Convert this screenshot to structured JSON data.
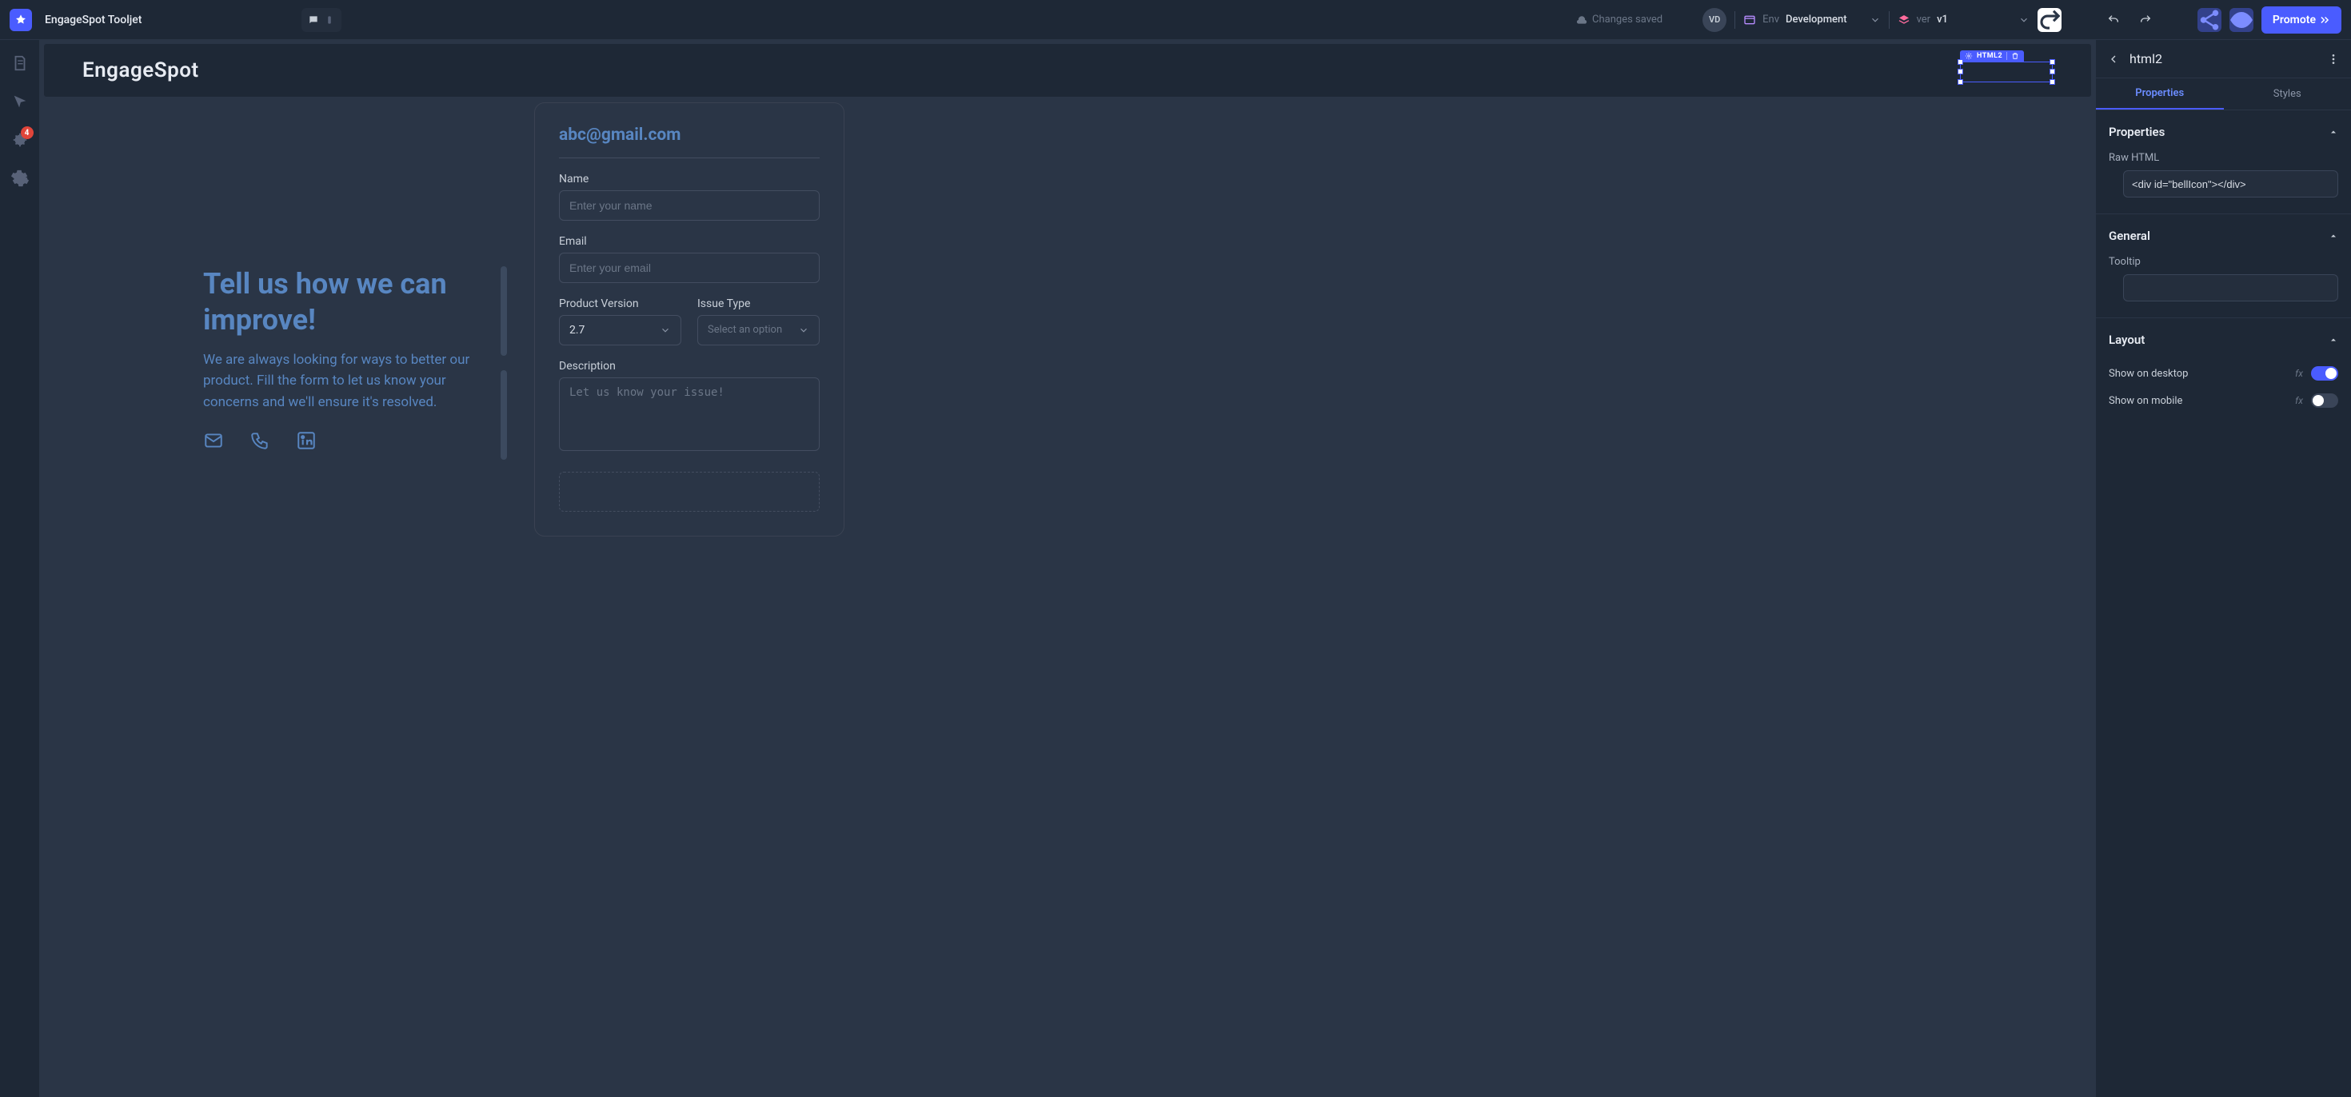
{
  "topbar": {
    "app_title": "EngageSpot Tooljet",
    "changes_saved": "Changes saved",
    "user_initials": "VD",
    "env_label": "Env",
    "env_value": "Development",
    "ver_label": "ver",
    "ver_value": "v1",
    "promote": "Promote"
  },
  "left_rail": {
    "debug_badge": "4"
  },
  "canvas": {
    "header_title": "EngageSpot",
    "selected_label": "HTML2",
    "content": {
      "heading": "Tell us how we can improve!",
      "subtext": "We are always looking for ways to better our product. Fill the form to let us know your concerns and we'll ensure it's resolved."
    },
    "form": {
      "email_heading": "abc@gmail.com",
      "name_label": "Name",
      "name_placeholder": "Enter your name",
      "email_label": "Email",
      "email_placeholder": "Enter your email",
      "pv_label": "Product Version",
      "pv_value": "2.7",
      "issue_label": "Issue Type",
      "issue_placeholder": "Select an option",
      "desc_label": "Description",
      "desc_placeholder": "Let us know your issue!"
    }
  },
  "inspector": {
    "title": "html2",
    "tab_props": "Properties",
    "tab_styles": "Styles",
    "section_props": "Properties",
    "raw_html_label": "Raw HTML",
    "raw_html_value": "<div id=\"bellIcon\"></div>",
    "section_general": "General",
    "tooltip_label": "Tooltip",
    "tooltip_value": "",
    "section_layout": "Layout",
    "show_desktop": "Show on desktop",
    "show_mobile": "Show on mobile",
    "fx": "fx"
  }
}
